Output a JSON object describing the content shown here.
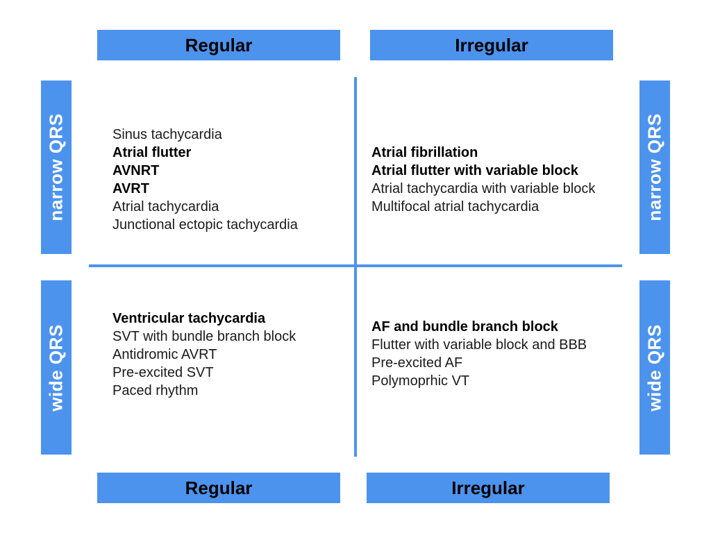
{
  "labels": {
    "top_left": "Regular",
    "top_right": "Irregular",
    "bottom_left": "Regular",
    "bottom_right": "Irregular",
    "left_top": "narrow QRS",
    "left_bottom": "wide QRS",
    "right_top": "narrow QRS",
    "right_bottom": "wide QRS"
  },
  "quadrants": {
    "narrow_regular": [
      {
        "text": "Sinus tachycardia",
        "bold": false
      },
      {
        "text": "Atrial flutter",
        "bold": true
      },
      {
        "text": "AVNRT",
        "bold": true
      },
      {
        "text": "AVRT",
        "bold": true
      },
      {
        "text": "Atrial tachycardia",
        "bold": false
      },
      {
        "text": "Junctional ectopic tachycardia",
        "bold": false
      }
    ],
    "narrow_irregular": [
      {
        "text": "Atrial fibrillation",
        "bold": true
      },
      {
        "text": "Atrial flutter with variable block",
        "bold": true
      },
      {
        "text": "Atrial tachycardia with variable block",
        "bold": false
      },
      {
        "text": "Multifocal atrial tachycardia",
        "bold": false
      }
    ],
    "wide_regular": [
      {
        "text": "Ventricular tachycardia",
        "bold": true
      },
      {
        "text": "SVT with bundle branch block",
        "bold": false
      },
      {
        "text": "Antidromic AVRT",
        "bold": false
      },
      {
        "text": "Pre-excited SVT",
        "bold": false
      },
      {
        "text": "Paced rhythm",
        "bold": false
      }
    ],
    "wide_irregular": [
      {
        "text": "AF and bundle branch block",
        "bold": true
      },
      {
        "text": "Flutter with variable block and BBB",
        "bold": false
      },
      {
        "text": "Pre-excited AF",
        "bold": false
      },
      {
        "text": "Polymoprhic VT",
        "bold": false
      }
    ]
  },
  "colors": {
    "accent": "#4c93ee"
  }
}
